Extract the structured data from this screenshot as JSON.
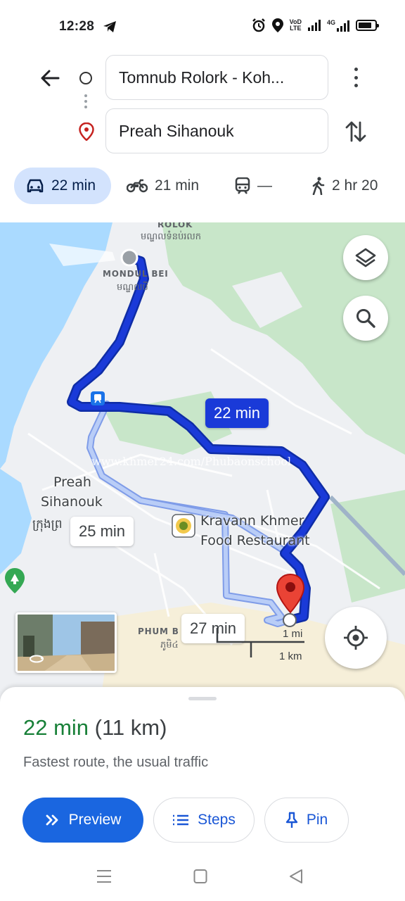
{
  "status_bar": {
    "time": "12:28",
    "icons": [
      "telegram-icon",
      "alarm-icon",
      "location-icon",
      "volte-icon",
      "signal-icon",
      "4g-signal-icon",
      "battery-icon"
    ],
    "volte_line1": "VoD",
    "volte_line2": "LTE",
    "net_label": "4G"
  },
  "directions": {
    "origin": "Tomnub Rolork - Koh...",
    "destination": "Preah Sihanouk"
  },
  "modes": [
    {
      "name": "car",
      "label": "22 min",
      "selected": true
    },
    {
      "name": "motorbike",
      "label": "21 min"
    },
    {
      "name": "transit",
      "label": "—"
    },
    {
      "name": "walk",
      "label": "2 hr 20"
    }
  ],
  "map": {
    "labels": {
      "rolok": "ROLOK",
      "rolok_km": "មណ្ឌលទំនប់រលក",
      "mondul": "MONDUL BEI",
      "mondul_km": "មណ្ឌលបី",
      "city_line1": "Preah",
      "city_line2": "Sihanouk",
      "city_km": "ក្រុងព្រ",
      "poi_line1": "Kravann Khmer",
      "poi_line2": "Food Restaurant",
      "phum": "PHUM B",
      "phum_km": "ភូមិ៤",
      "watermark": "www.khmer24.com/Phubaonschool"
    },
    "routes": [
      {
        "label": "22 min",
        "primary": true
      },
      {
        "label": "25 min"
      },
      {
        "label": "27 min"
      }
    ],
    "scale": {
      "mi": "1 mi",
      "km": "1 km"
    },
    "colors": {
      "water": "#aadaff",
      "park": "#c8e6c9",
      "route_primary": "#1a3ad8",
      "route_alt": "#a9c3f5"
    }
  },
  "sheet": {
    "duration": "22 min",
    "distance": "(11 km)",
    "description": "Fastest route, the usual traffic",
    "buttons": {
      "preview": "Preview",
      "steps": "Steps",
      "pin": "Pin"
    }
  }
}
